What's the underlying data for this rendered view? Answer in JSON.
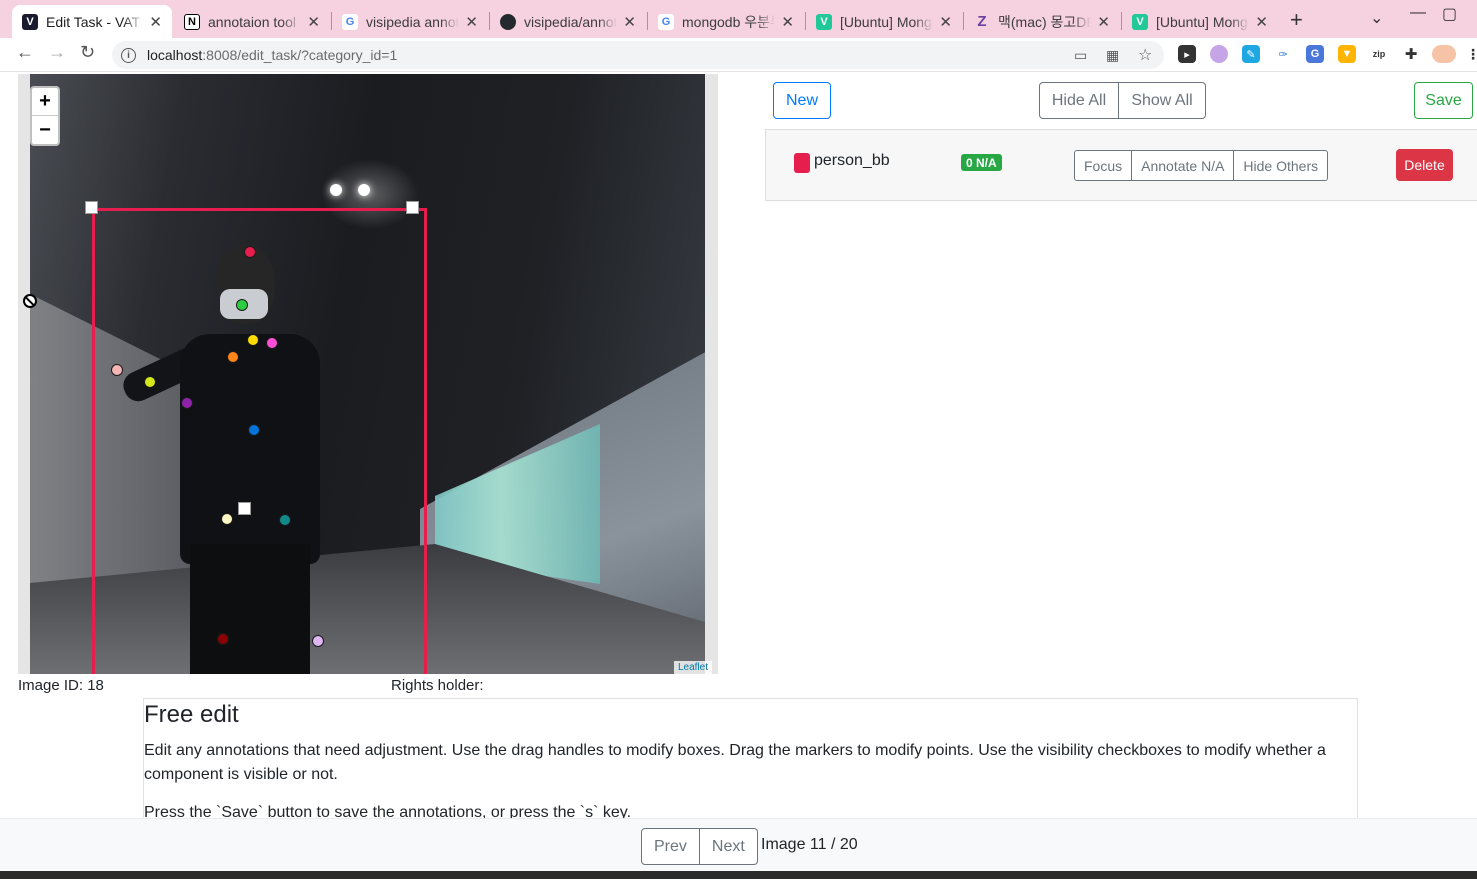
{
  "browser": {
    "tabs": [
      {
        "label": "Edit Task - VAT",
        "icon": "v-app-icon",
        "color": "#1a1a2e",
        "glyph": "V",
        "active": true
      },
      {
        "label": "annotaion tool",
        "icon": "notion-icon",
        "color": "#000000",
        "glyph": "N",
        "active": false
      },
      {
        "label": "visipedia annotation",
        "icon": "google-icon",
        "color": "#4285f4",
        "glyph": "G",
        "active": false
      },
      {
        "label": "visipedia/annotation",
        "icon": "github-icon",
        "color": "#24292e",
        "glyph": "●",
        "active": false
      },
      {
        "label": "mongodb 우분투",
        "icon": "google-icon",
        "color": "#4285f4",
        "glyph": "G",
        "active": false
      },
      {
        "label": "[Ubuntu] MongoDB",
        "icon": "velog-icon",
        "color": "#20c997",
        "glyph": "v",
        "active": false
      },
      {
        "label": "맥(mac) 몽고DB",
        "icon": "zum-icon",
        "color": "#6b3fa0",
        "glyph": "Z",
        "active": false
      },
      {
        "label": "[Ubuntu] MongoDB",
        "icon": "velog-icon",
        "color": "#20c997",
        "glyph": "v",
        "active": false
      }
    ],
    "url_host": "localhost",
    "url_path": ":8008/edit_task/?category_id=1"
  },
  "map": {
    "zoom_in": "+",
    "zoom_out": "−",
    "attribution": "Leaflet"
  },
  "image_meta": {
    "image_id": "Image ID: 18",
    "rights": "Rights holder:"
  },
  "controls": {
    "new": "New",
    "hide_all": "Hide All",
    "show_all": "Show All",
    "save": "Save"
  },
  "annotation": {
    "name": "person_bb",
    "badge": "0 N/A",
    "color": "#e61e4d",
    "focus": "Focus",
    "annotate_na": "Annotate N/A",
    "hide_others": "Hide Others",
    "delete": "Delete"
  },
  "instructions": {
    "title": "Free edit",
    "p1": "Edit any annotations that need adjustment. Use the drag handles to modify boxes. Drag the markers to modify points. Use the visibility checkboxes to modify whether a component is visible or not.",
    "p2": "Press the `Save` button to save the annotations, or press the `s` key."
  },
  "footer": {
    "prev": "Prev",
    "next": "Next",
    "page": "Image 11 / 20"
  },
  "keypoint_colors": [
    "#e61e4d",
    "#2ecc40",
    "#ffdc00",
    "#ff4fd8",
    "#ff851b",
    "#f7b6b6",
    "#d4e81b",
    "#8e24aa",
    "#0074d9",
    "#fff8c4",
    "#138a8a",
    "#8b0000",
    "#e0b7f5"
  ]
}
